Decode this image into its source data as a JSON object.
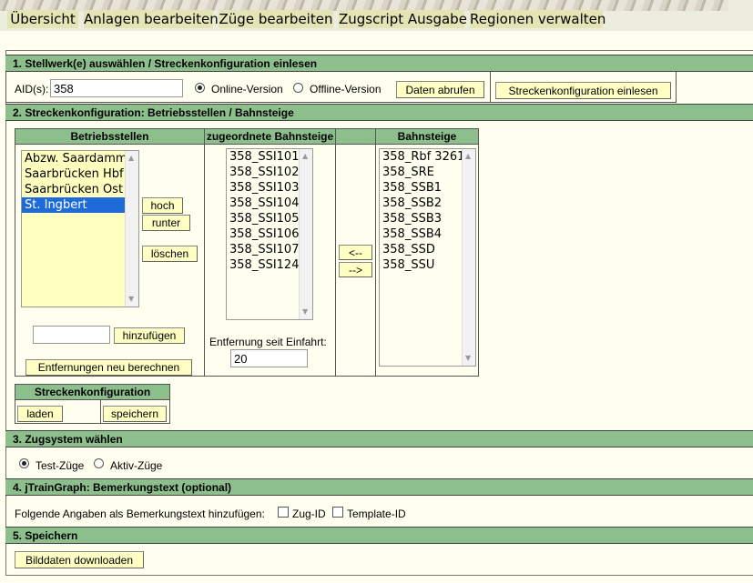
{
  "nav": {
    "tabs": [
      "Übersicht",
      "Anlagen bearbeiten",
      "Züge bearbeiten",
      "Zugscript Ausgabe",
      "Regionen verwalten"
    ]
  },
  "section1": {
    "title": "1. Stellwerk(e) auswählen / Streckenkonfiguration einlesen",
    "aid_label": "AID(s):",
    "aid_value": "358",
    "online_label": "Online-Version",
    "offline_label": "Offline-Version",
    "fetch_button": "Daten abrufen",
    "read_config_button": "Streckenkonfiguration einlesen"
  },
  "section2": {
    "title": "2. Streckenkonfiguration: Betriebsstellen / Bahnsteige",
    "col_betriebsstellen": "Betriebsstellen",
    "col_zugeordnet": "zugeordnete Bahnsteige",
    "col_bahnsteige": "Bahnsteige",
    "betriebsstellen": [
      "Abzw. Saardamm",
      "Saarbrücken Hbf",
      "Saarbrücken Ost",
      "St. Ingbert"
    ],
    "selected_betriebsstelle": "St. Ingbert",
    "btn_up": "hoch",
    "btn_down": "runter",
    "btn_delete": "löschen",
    "new_station_value": "",
    "btn_add": "hinzufügen",
    "btn_recalc": "Entfernungen neu berechnen",
    "assigned_platforms": [
      "358_SSI101",
      "358_SSI102",
      "358_SSI103",
      "358_SSI104",
      "358_SSI105",
      "358_SSI106",
      "358_SSI107",
      "358_SSI124"
    ],
    "distance_label": "Entfernung seit Einfahrt:",
    "distance_value": "20",
    "btn_move_left": "<--",
    "btn_move_right": "-->",
    "platforms": [
      "358_Rbf 3261",
      "358_SRE",
      "358_SSB1",
      "358_SSB2",
      "358_SSB3",
      "358_SSB4",
      "358_SSD",
      "358_SSU"
    ],
    "config_title": "Streckenkonfiguration",
    "btn_load": "laden",
    "btn_save": "speichern"
  },
  "section3": {
    "title": "3. Zugsystem wählen",
    "test_label": "Test-Züge",
    "active_label": "Aktiv-Züge"
  },
  "section4": {
    "title": "4. jTrainGraph: Bemerkungstext (optional)",
    "lead": "Folgende Angaben als Bemerkungstext hinzufügen:",
    "zug_id_label": "Zug-ID",
    "template_id_label": "Template-ID"
  },
  "section5": {
    "title": "5. Speichern",
    "download_button": "Bilddaten downloaden"
  },
  "colors": {
    "section_header": "#8dbf8d",
    "nav_tab": "#e4e4b4",
    "listbox_yellow": "#ffffc0",
    "selection": "#1e6ad6"
  }
}
